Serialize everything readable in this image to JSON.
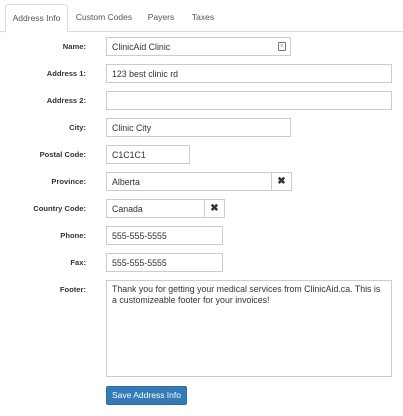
{
  "tabs": [
    {
      "label": "Address Info"
    },
    {
      "label": "Custom Codes"
    },
    {
      "label": "Payers"
    },
    {
      "label": "Taxes"
    }
  ],
  "form": {
    "name": {
      "label": "Name:",
      "value": "ClinicAid Clinic"
    },
    "address1": {
      "label": "Address 1:",
      "value": "123 best clinic rd"
    },
    "address2": {
      "label": "Address 2:",
      "value": ""
    },
    "city": {
      "label": "City:",
      "value": "Clinic City"
    },
    "postal_code": {
      "label": "Postal Code:",
      "value": "C1C1C1"
    },
    "province": {
      "label": "Province:",
      "value": "Alberta"
    },
    "country_code": {
      "label": "Country Code:",
      "value": "Canada"
    },
    "phone": {
      "label": "Phone:",
      "value": "555-555-5555"
    },
    "fax": {
      "label": "Fax:",
      "value": "555-555-5555"
    },
    "footer": {
      "label": "Footer:",
      "value": "Thank you for getting your medical services from ClinicAid.ca. This is a customizeable footer for your invoices!"
    }
  },
  "clear_glyph": "✖",
  "save_label": "Save Address Info"
}
